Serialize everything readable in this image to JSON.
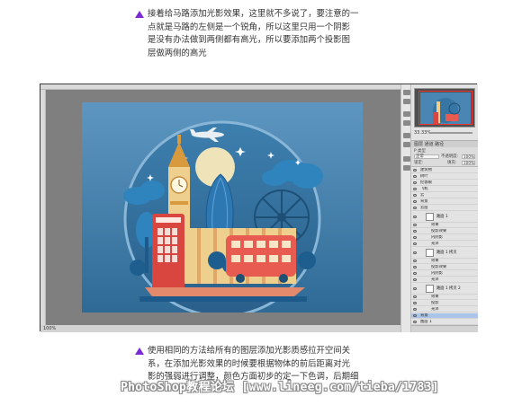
{
  "top_note": {
    "lines": [
      "接着给马路添加光影效果，这里就不多说了，要注意的一",
      "点就是马路的左侧是一个锐角，所以这里只用一个阴影",
      "是没有办法做到两侧都有高光，所以要添加两个投影图",
      "层做两侧的高光"
    ]
  },
  "bottom_note": {
    "lines": [
      "使用相同的方法给所有的图层添加光影质感拉开空间关",
      "系，在添加光影效果的时候要根据物体的前后距离对光",
      "影的强弱进行调整，颜色方面初步的定一下色调，后期细"
    ]
  },
  "watermark": "PhotoShop教程论坛 [www.lineeg.com/tieba/1783]",
  "photoshop": {
    "status_zoom": "100%",
    "nav_zoom": "33.33%",
    "layers_tab": "图层  通道  路径",
    "layer_filter": "P 类型",
    "blend_mode": "正常",
    "opacity_label": "不透明度:",
    "opacity_value": "100%",
    "lock_label": "锁定:",
    "fill_label": "填充:",
    "fill_value": "100%",
    "layers": [
      {
        "name": "建筑物",
        "kind": "group"
      },
      {
        "name": "树叶",
        "kind": "group"
      },
      {
        "name": "伦敦眼",
        "kind": "group"
      },
      {
        "name": "飞机",
        "kind": "group"
      },
      {
        "name": "云",
        "kind": "group"
      },
      {
        "name": "背景",
        "kind": "group"
      },
      {
        "name": "云层",
        "kind": "group"
      },
      {
        "name": "路面 1",
        "kind": "thumb"
      },
      {
        "name": "效果",
        "kind": "fx"
      },
      {
        "name": "投影效果",
        "kind": "fx"
      },
      {
        "name": "内阴影",
        "kind": "fx"
      },
      {
        "name": "光泽",
        "kind": "fx"
      },
      {
        "name": "路面 1 拷贝",
        "kind": "thumb"
      },
      {
        "name": "效果",
        "kind": "fx"
      },
      {
        "name": "投影效果",
        "kind": "fx"
      },
      {
        "name": "内阴影",
        "kind": "fx"
      },
      {
        "name": "光泽",
        "kind": "fx"
      },
      {
        "name": "路面 1 拷贝 2",
        "kind": "thumb"
      },
      {
        "name": "效果",
        "kind": "fx"
      },
      {
        "name": "投影",
        "kind": "fx"
      },
      {
        "name": "光泽",
        "kind": "fx"
      },
      {
        "name": "背景",
        "kind": "selected"
      },
      {
        "name": "图层 1",
        "kind": "group"
      }
    ]
  },
  "colors": {
    "accent_triangle": "#7a2bd6",
    "canvas_bg": "#3f7aa3",
    "bus_red": "#e85b50",
    "booth_red": "#d9463f",
    "sand": "#efcf8e",
    "cloud_blue": "#2f84bd"
  }
}
